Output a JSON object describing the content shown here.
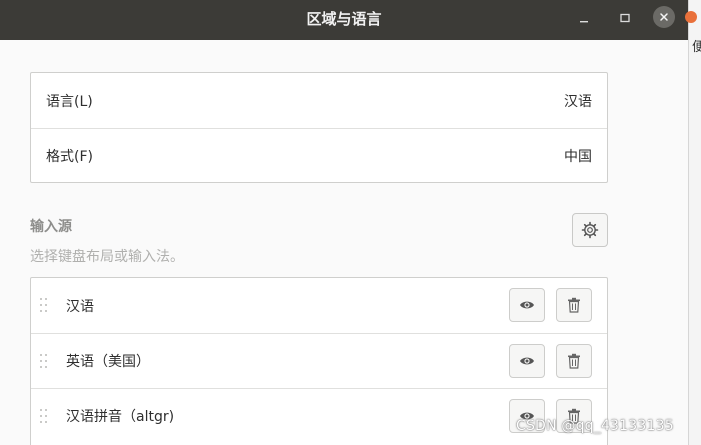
{
  "window": {
    "title": "区域与语言"
  },
  "background": {
    "partial_char": "便"
  },
  "region": {
    "language_label": "语言(L)",
    "language_value": "汉语",
    "format_label": "格式(F)",
    "format_value": "中国"
  },
  "input_sources": {
    "title": "输入源",
    "subtitle": "选择键盘布局或输入法。",
    "items": [
      {
        "label": "汉语"
      },
      {
        "label": "英语（美国）"
      },
      {
        "label": "汉语拼音（altgr)"
      }
    ]
  },
  "watermark": "CSDN @qq_43133135",
  "icons": {
    "minimize": "minimize-icon",
    "maximize": "maximize-icon",
    "close": "close-icon",
    "settings": "gear-icon",
    "preview": "eye-icon",
    "remove": "trash-icon",
    "drag": "drag-handle-icon"
  },
  "colors": {
    "titlebar": "#3c3b37",
    "background": "#fafafa",
    "accent_orange": "#e9703a"
  }
}
